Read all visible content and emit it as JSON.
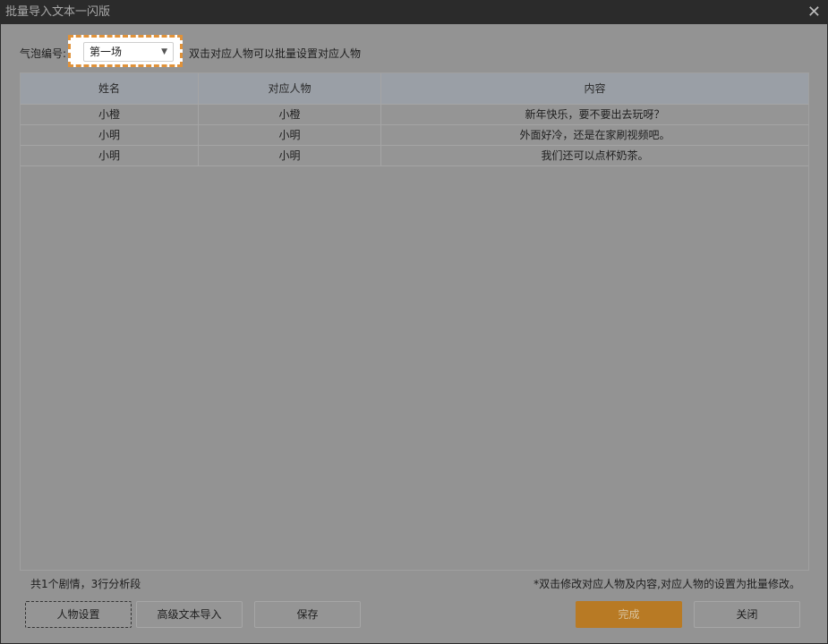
{
  "window": {
    "title": "批量导入文本一闪版",
    "close": "✕"
  },
  "filter": {
    "label": "气泡编号:",
    "selected": "第一场",
    "hint": "双击对应人物可以批量设置对应人物"
  },
  "table": {
    "headers": [
      "姓名",
      "对应人物",
      "内容"
    ],
    "rows": [
      [
        "小橙",
        "小橙",
        "新年快乐，要不要出去玩呀？"
      ],
      [
        "小明",
        "小明",
        "外面好冷，还是在家刷视频吧。"
      ],
      [
        "小明",
        "小明",
        "我们还可以点杯奶茶。"
      ]
    ]
  },
  "footer": {
    "summary": "共1个剧情，3行分析段",
    "note": "*双击修改对应人物及内容,对应人物的设置为批量修改。"
  },
  "buttons": {
    "character": "人物设置",
    "advanced": "高级文本导入",
    "save": "保存",
    "done": "完成",
    "close": "关闭"
  }
}
